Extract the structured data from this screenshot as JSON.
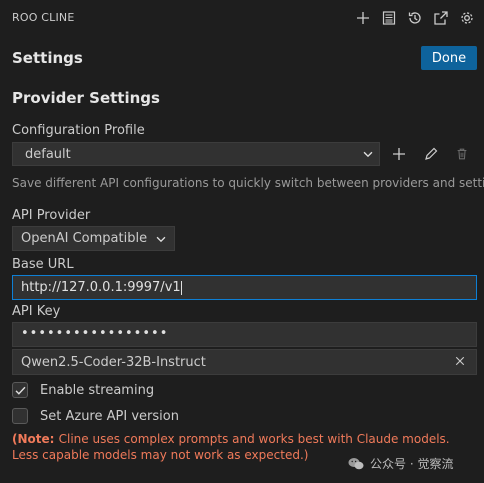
{
  "header": {
    "app_title": "ROO CLINE",
    "icons": [
      "plus-icon",
      "history-list-icon",
      "history-icon",
      "popout-icon",
      "gear-icon"
    ]
  },
  "settings": {
    "title": "Settings",
    "done_label": "Done"
  },
  "provider_settings": {
    "section_title": "Provider Settings",
    "config_profile_label": "Configuration Profile",
    "config_profile_value": "default",
    "config_hint": "Save different API configurations to quickly switch between providers and settings",
    "api_provider_label": "API Provider",
    "api_provider_value": "OpenAI Compatible",
    "base_url_label": "Base URL",
    "base_url_value": "http://127.0.0.1:9997/v1",
    "api_key_label": "API Key",
    "api_key_value": "•••••••••••••••••",
    "model_value": "Qwen2.5-Coder-32B-Instruct",
    "enable_streaming_label": "Enable streaming",
    "enable_streaming_checked": true,
    "azure_api_label": "Set Azure API version",
    "azure_api_checked": false,
    "note_prefix": "(Note: ",
    "note_text": "Cline uses complex prompts and works best with Claude models. Less capable models may not work as expected.)"
  },
  "watermark": {
    "text": "公众号 · 觉察流"
  },
  "colors": {
    "background": "#1e1e1e",
    "accent": "#0e639c",
    "focus_border": "#0e7fd4",
    "warning_text": "#f07a5a"
  }
}
